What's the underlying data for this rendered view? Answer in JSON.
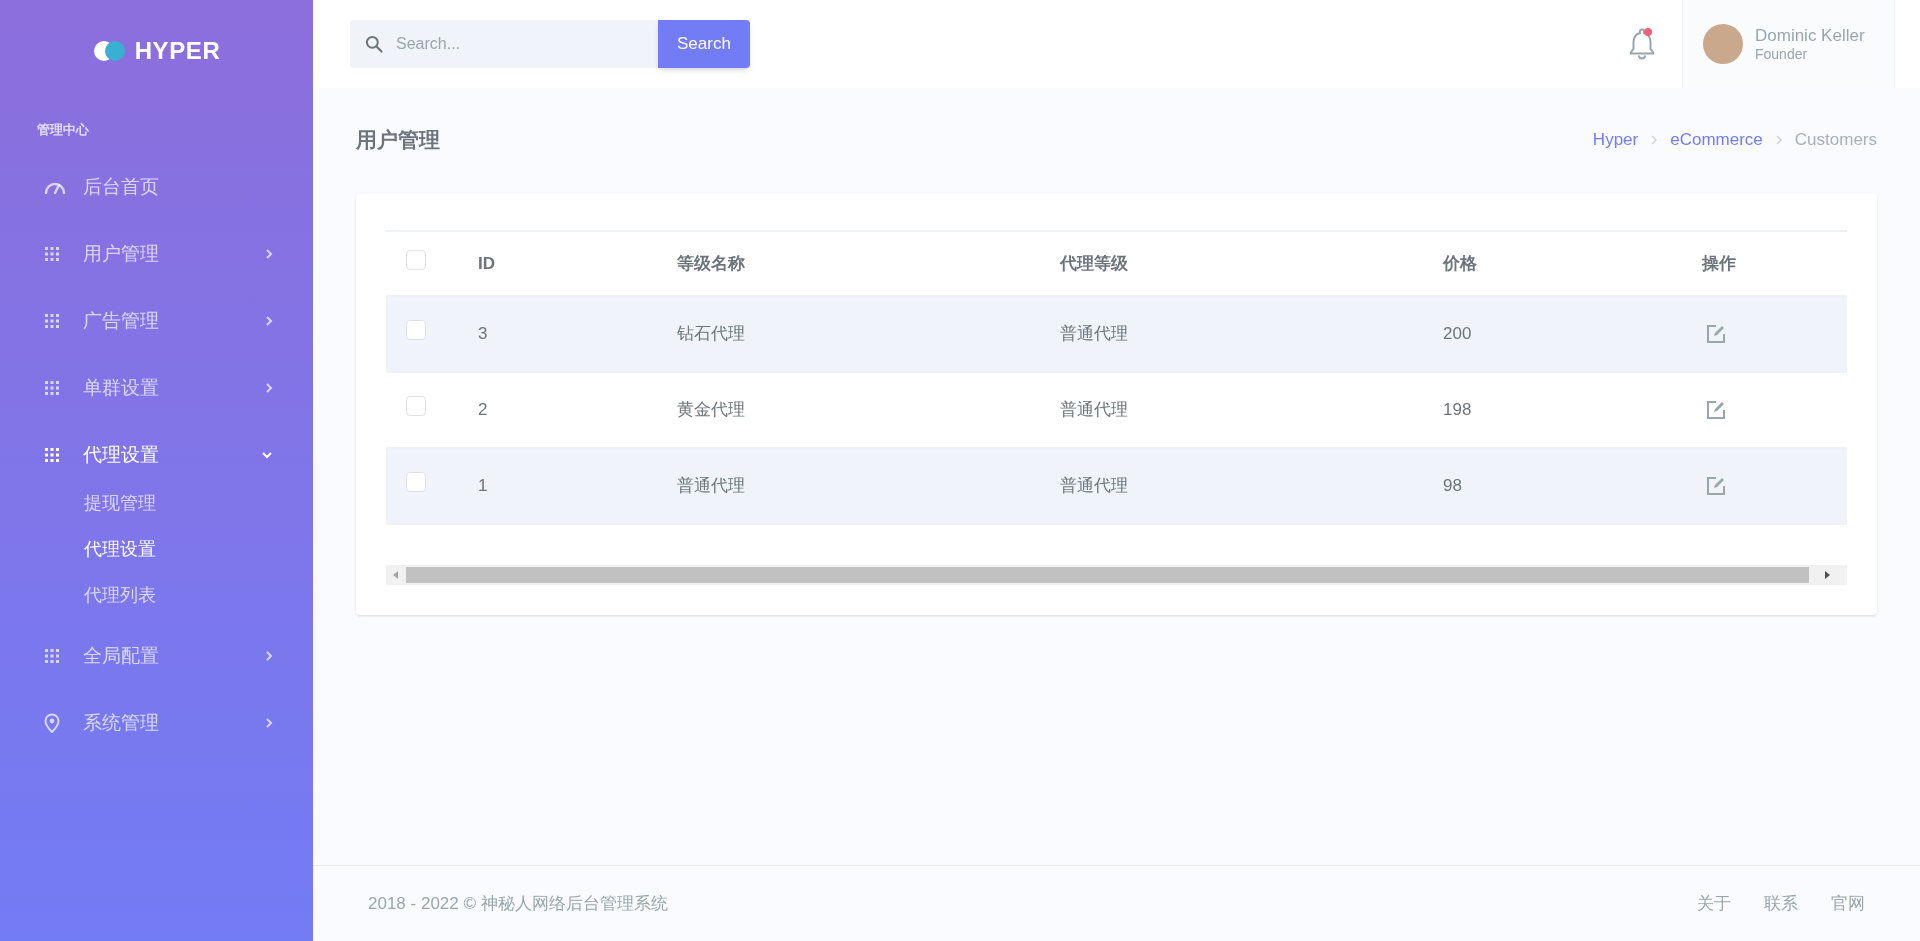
{
  "sidebar": {
    "logo": "HYPER",
    "section_title": "管理中心",
    "items": [
      {
        "label": "后台首页",
        "kind": "gauge"
      },
      {
        "label": "用户管理",
        "kind": "grid",
        "expanded": false
      },
      {
        "label": "广告管理",
        "kind": "grid",
        "expanded": false
      },
      {
        "label": "单群设置",
        "kind": "grid",
        "expanded": false
      },
      {
        "label": "代理设置",
        "kind": "grid",
        "expanded": true,
        "children": [
          {
            "label": "提现管理",
            "selected": false
          },
          {
            "label": "代理设置",
            "selected": true
          },
          {
            "label": "代理列表",
            "selected": false
          }
        ]
      },
      {
        "label": "全局配置",
        "kind": "grid",
        "expanded": false
      },
      {
        "label": "系统管理",
        "kind": "pin",
        "expanded": false
      }
    ]
  },
  "topbar": {
    "search": {
      "placeholder": "Search...",
      "button": "Search"
    },
    "user": {
      "name": "Dominic Keller",
      "role": "Founder"
    }
  },
  "page": {
    "title": "用户管理",
    "breadcrumb": [
      {
        "label": "Hyper",
        "current": false
      },
      {
        "label": "eCommerce",
        "current": false
      },
      {
        "label": "Customers",
        "current": true
      }
    ]
  },
  "table": {
    "select_all_checked": false,
    "columns": [
      "ID",
      "等级名称",
      "代理等级",
      "价格",
      "操作"
    ],
    "rows": [
      {
        "checked": false,
        "cells": [
          "3",
          "钻石代理",
          "普通代理",
          "200"
        ]
      },
      {
        "checked": false,
        "cells": [
          "2",
          "黄金代理",
          "普通代理",
          "198"
        ]
      },
      {
        "checked": false,
        "cells": [
          "1",
          "普通代理",
          "普通代理",
          "98"
        ]
      }
    ]
  },
  "footer": {
    "copyright": "2018 - 2022 © 神秘人网络后台管理系统",
    "links": [
      "关于",
      "联系",
      "官网"
    ]
  }
}
